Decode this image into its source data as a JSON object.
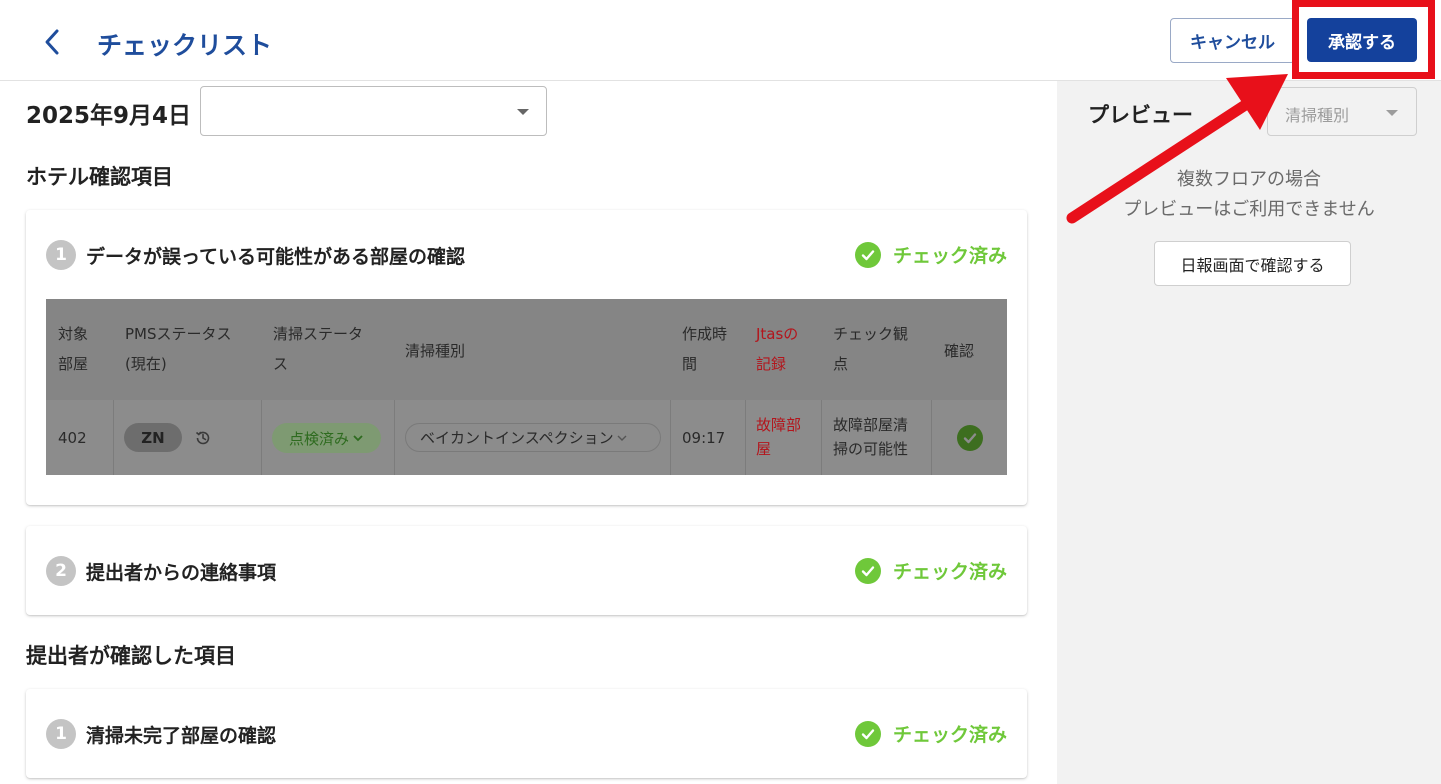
{
  "header": {
    "title": "チェックリスト",
    "cancel_label": "キャンセル",
    "approve_label": "承認する"
  },
  "date": {
    "label": "2025年9月4日",
    "select_value": ""
  },
  "sections": {
    "hotel": "ホテル確認項目",
    "submitter": "提出者が確認した項目"
  },
  "checked_label": "チェック済み",
  "cards": {
    "c1": {
      "num": "1",
      "title": "データが誤っている可能性がある部屋の確認"
    },
    "c2": {
      "num": "2",
      "title": "提出者からの連絡事項"
    },
    "c3": {
      "num": "1",
      "title": "清掃未完了部屋の確認"
    }
  },
  "table": {
    "headers": {
      "room": [
        "対象",
        "部屋"
      ],
      "pms": [
        "PMSステータス",
        "(現在)"
      ],
      "cleaning_status": [
        "清掃ステータ",
        "ス"
      ],
      "cleaning_type": "清掃種別",
      "created": [
        "作成時",
        "間"
      ],
      "jtas": [
        "Jtasの",
        "記録"
      ],
      "check_point": [
        "チェック観",
        "点"
      ],
      "confirm": "確認"
    },
    "row": {
      "room": "402",
      "pms": "ZN",
      "cleaning_status": "点検済み",
      "cleaning_type": "ベイカントインスペクション",
      "created": "09:17",
      "jtas": [
        "故障部",
        "屋"
      ],
      "check_point": [
        "故障部屋清",
        "掃の可能性"
      ]
    }
  },
  "preview": {
    "title": "プレビュー",
    "type_placeholder": "清掃種別",
    "msg_line1": "複数フロアの場合",
    "msg_line2": "プレビューはご利用できません",
    "report_button": "日報画面で確認する"
  },
  "colors": {
    "brand": "#14419c",
    "check_green": "#6fc83a",
    "annotation_red": "#e8101a"
  }
}
